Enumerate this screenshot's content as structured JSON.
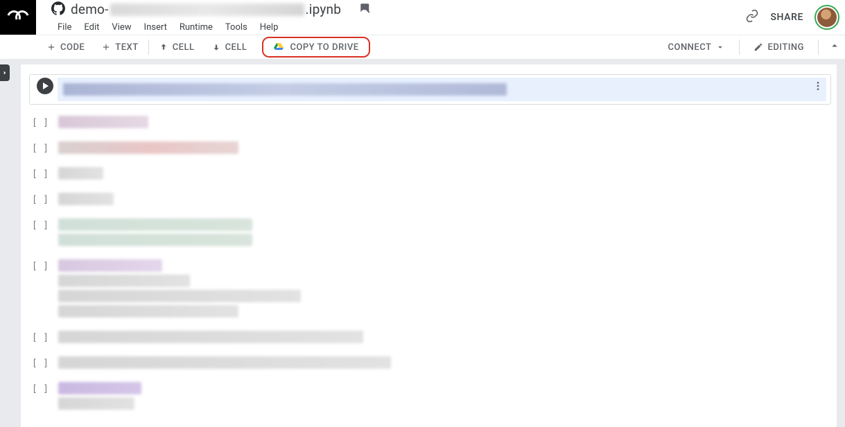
{
  "notebook_title_prefix": "demo-",
  "notebook_title_suffix": ".ipynb",
  "menus": {
    "file": "File",
    "edit": "Edit",
    "view": "View",
    "insert": "Insert",
    "runtime": "Runtime",
    "tools": "Tools",
    "help": "Help"
  },
  "share_label": "SHARE",
  "toolbar": {
    "code_label": "CODE",
    "text_label": "TEXT",
    "cell_up_label": "CELL",
    "cell_down_label": "CELL",
    "copy_drive_label": "COPY TO DRIVE",
    "connect_label": "CONNECT",
    "editing_label": "EDITING"
  },
  "prompt_placeholder": "[  ]"
}
